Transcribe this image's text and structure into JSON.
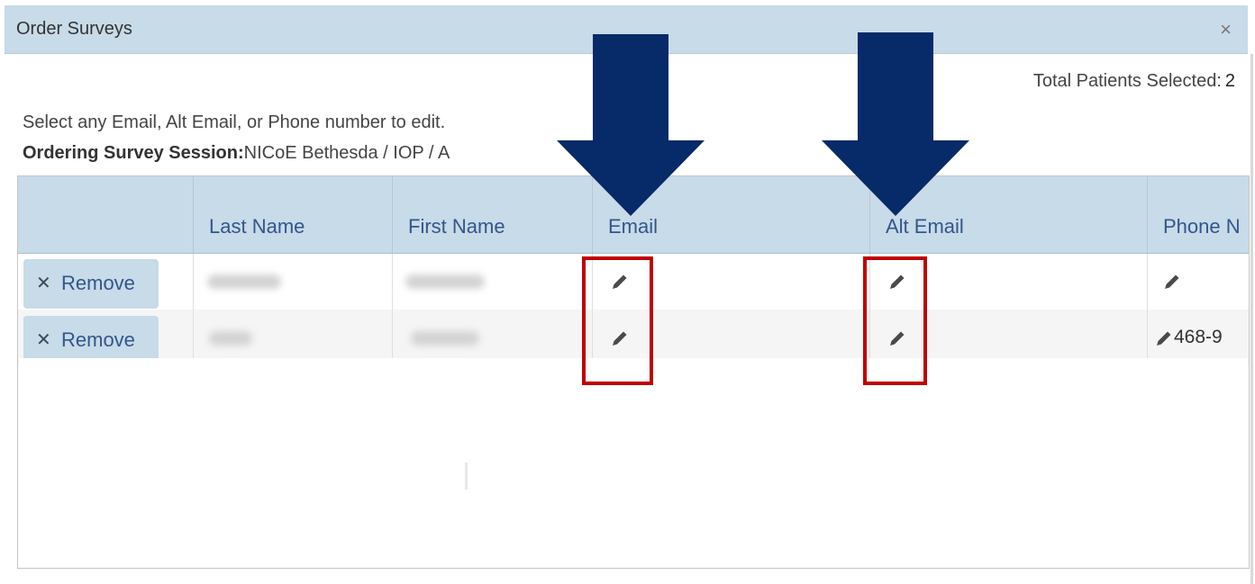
{
  "dialog": {
    "title": "Order Surveys",
    "close_symbol": "×"
  },
  "total": {
    "label": "Total Patients Selected:",
    "value": "2"
  },
  "instructions": "Select any Email, Alt Email, or Phone number to edit.",
  "session": {
    "label": "Ordering Survey Session:",
    "value": "NICoE Bethesda / IOP / A"
  },
  "table": {
    "columns": [
      "",
      "Last Name",
      "First Name",
      "Email",
      "Alt Email",
      "Phone N"
    ],
    "rows": [
      {
        "remove_label": "Remove",
        "phone": ""
      },
      {
        "remove_label": "Remove",
        "phone": "468-9"
      }
    ]
  },
  "colors": {
    "header_bg": "#c7dbe8",
    "header_text": "#34558b",
    "arrow": "#072a68",
    "highlight": "#c00000"
  }
}
